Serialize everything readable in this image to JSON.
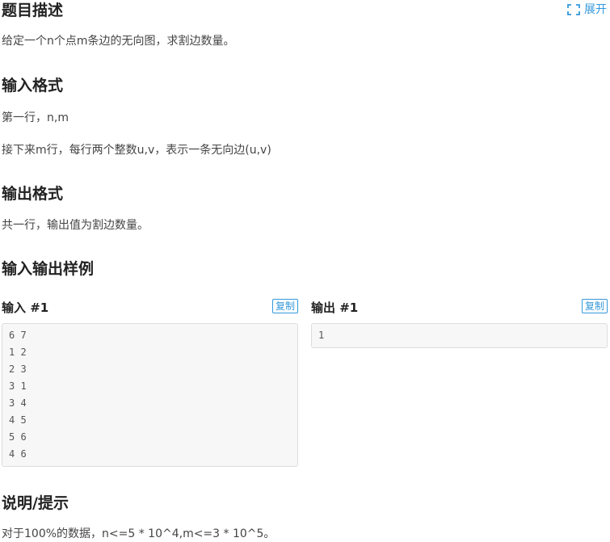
{
  "description": {
    "heading": "题目描述",
    "text": "给定一个n个点m条边的无向图，求割边数量。",
    "expand_label": "展开"
  },
  "input_format": {
    "heading": "输入格式",
    "line1": "第一行，n,m",
    "line2": "接下来m行，每行两个整数u,v，表示一条无向边(u,v)"
  },
  "output_format": {
    "heading": "输出格式",
    "text": "共一行，输出值为割边数量。"
  },
  "samples": {
    "heading": "输入输出样例",
    "input": {
      "title": "输入 #1",
      "copy_label": "复制",
      "code": "6 7\n1 2\n2 3\n3 1\n3 4\n4 5\n5 6\n4 6"
    },
    "output": {
      "title": "输出 #1",
      "copy_label": "复制",
      "code": "1"
    }
  },
  "hint": {
    "heading": "说明/提示",
    "text": "对于100%的数据，n<=5 * 10^4,m<=3 * 10^5。"
  },
  "colors": {
    "accent": "#3498db",
    "code_bg": "#f7f7f7"
  },
  "icons": {
    "expand": "expand-icon"
  }
}
